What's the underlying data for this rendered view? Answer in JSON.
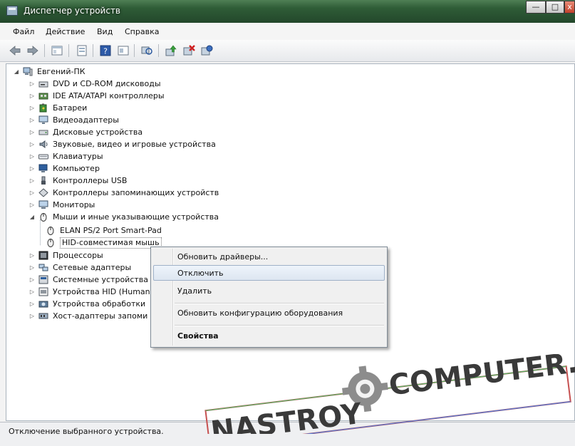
{
  "window": {
    "title": "Диспетчер устройств",
    "controls": {
      "minimize": "—",
      "maximize": "□",
      "close": "x"
    }
  },
  "menu": [
    "Файл",
    "Действие",
    "Вид",
    "Справка"
  ],
  "toolbar": [
    "back-icon",
    "forward-icon",
    "properties-icon",
    "show-hide-icon",
    "help-icon",
    "view-icon",
    "scan-icon",
    "update-driver-icon",
    "disable-icon",
    "uninstall-icon"
  ],
  "tree": {
    "root": "Евгений-ПК",
    "categories": [
      "DVD и CD-ROM дисководы",
      "IDE ATA/ATAPI контроллеры",
      "Батареи",
      "Видеоадаптеры",
      "Дисковые устройства",
      "Звуковые, видео и игровые устройства",
      "Клавиатуры",
      "Компьютер",
      "Контроллеры USB",
      "Контроллеры запоминающих устройств",
      "Мониторы",
      "Мыши и иные указывающие устройства"
    ],
    "mice_children": [
      "ELAN PS/2 Port Smart-Pad",
      "HID-совместимая мышь"
    ],
    "categories_after": [
      "Процессоры",
      "Сетевые адаптеры",
      "Системные устройства",
      "Устройства HID (Human",
      "Устройства обработки",
      "Хост-адаптеры запоми"
    ]
  },
  "context_menu": {
    "items": [
      "Обновить драйверы...",
      "Отключить",
      "Удалить",
      "Обновить конфигурацию оборудования",
      "Свойства"
    ]
  },
  "status": "Отключение выбранного устройства.",
  "watermark": {
    "left": "NASTROY",
    "right": "COMPUTER.R"
  }
}
